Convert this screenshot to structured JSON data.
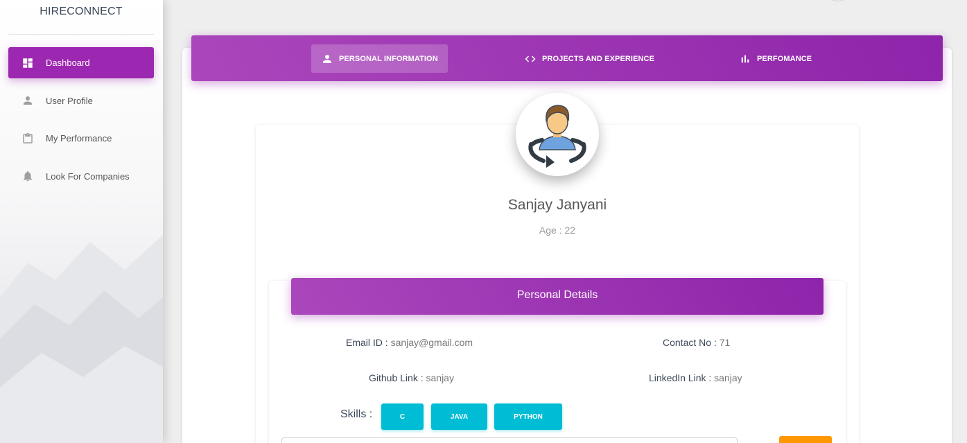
{
  "app": {
    "title": "HIRECONNECT"
  },
  "sidebar": {
    "items": [
      {
        "label": "Dashboard",
        "icon": "dashboard-icon",
        "active": true
      },
      {
        "label": "User Profile",
        "icon": "person-icon",
        "active": false
      },
      {
        "label": "My Performance",
        "icon": "clipboard-icon",
        "active": false
      },
      {
        "label": "Look For Companies",
        "icon": "bell-icon",
        "active": false
      }
    ]
  },
  "tabs": [
    {
      "label": "PERSONAL INFORMATION",
      "icon": "person-icon",
      "active": true
    },
    {
      "label": "PROJECTS AND EXPERIENCE",
      "icon": "code-icon",
      "active": false
    },
    {
      "label": "PERFOMANCE",
      "icon": "bar-chart-icon",
      "active": false
    }
  ],
  "profile": {
    "name": "Sanjay Janyani",
    "age": "Age : 22"
  },
  "details": {
    "header": "Personal Details",
    "email_label": "Email ID : ",
    "email_value": "sanjay@gmail.com",
    "contact_label": "Contact No : ",
    "contact_value": "71",
    "github_label": "Github Link : ",
    "github_value": "sanjay",
    "linkedin_label": "LinkedIn Link : ",
    "linkedin_value": "sanjay",
    "skills_label": "Skills :",
    "skills": [
      "C",
      "JAVA",
      "PYTHON"
    ]
  },
  "colors": {
    "primary": "#9c27b0",
    "chip": "#00bcd4",
    "warning": "#ff9800"
  }
}
